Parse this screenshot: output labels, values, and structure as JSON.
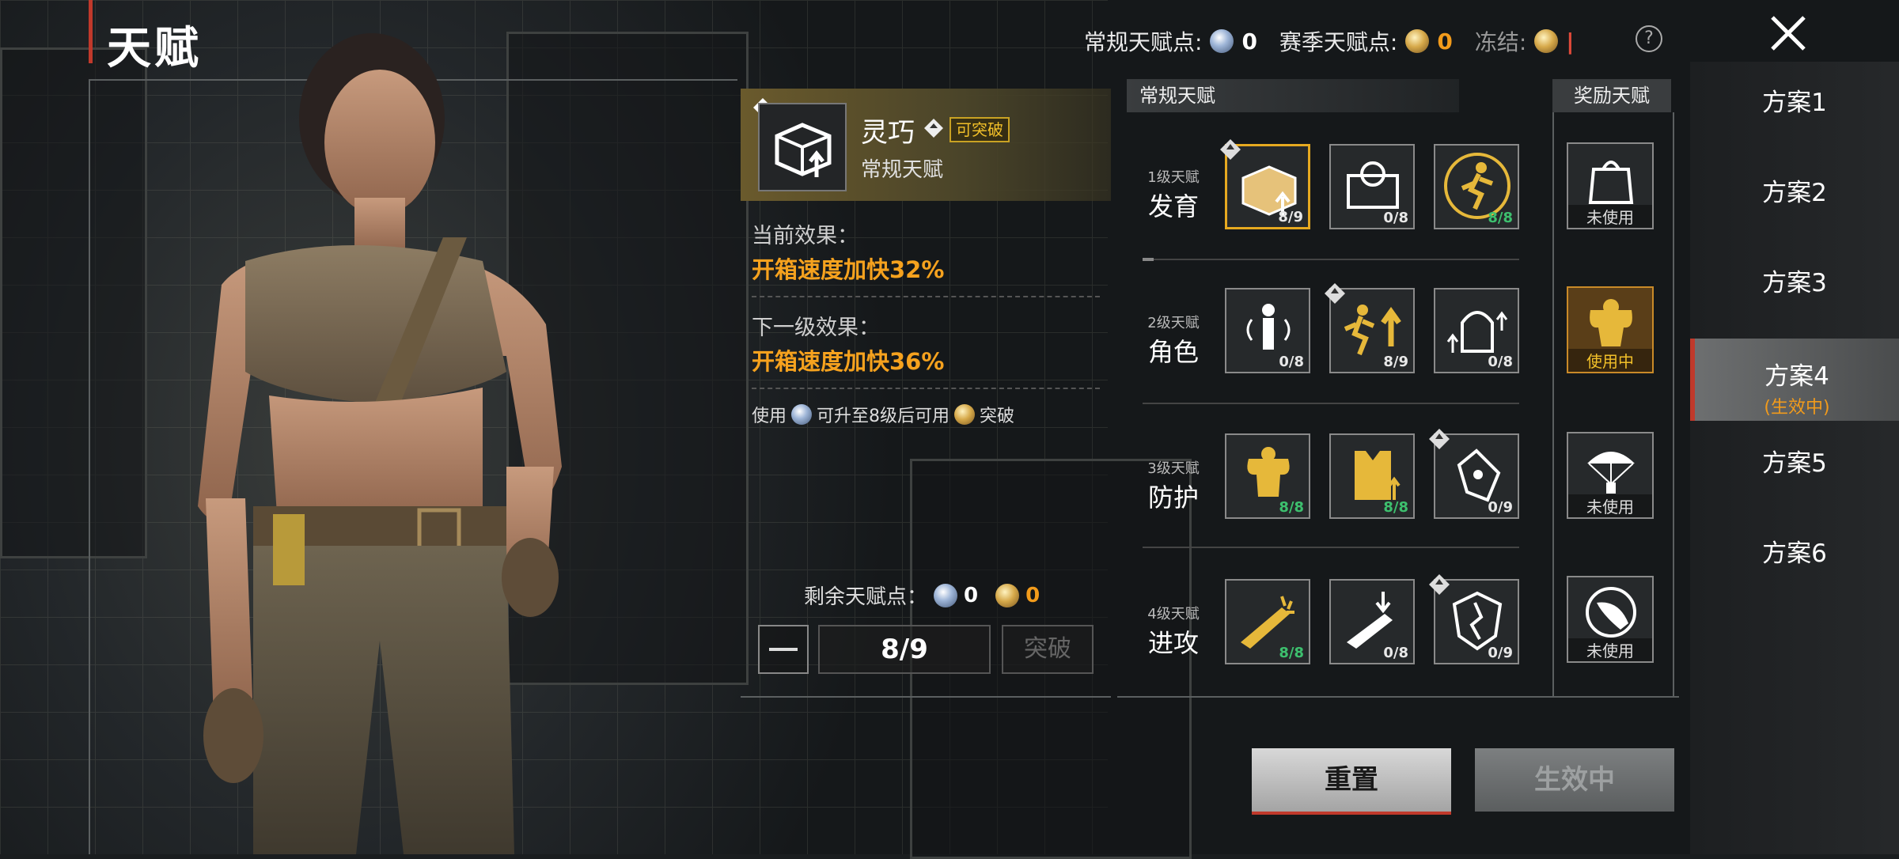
{
  "screen_title": "天赋",
  "header": {
    "regular_points_label": "常规天赋点:",
    "regular_points_value": "0",
    "season_points_label": "赛季天赋点:",
    "season_points_value": "0",
    "frozen_label": "冻结:",
    "frozen_value": "|",
    "help_icon": "?"
  },
  "detail": {
    "talent_name": "灵巧",
    "break_badge": "可突破",
    "talent_type": "常规天赋",
    "current_label": "当前效果：",
    "current_value": "开箱速度加快32%",
    "next_label": "下一级效果：",
    "next_value": "开箱速度加快36%",
    "usage_prefix": "使用",
    "usage_middle": "可升至8级后可用",
    "usage_suffix": "突破",
    "remaining_label": "剩余天赋点：",
    "remaining_regular": "0",
    "remaining_season": "0",
    "level_display": "8/9",
    "break_button": "突破"
  },
  "grid": {
    "regular_header": "常规天赋",
    "reward_header": "奖励天赋",
    "rows": [
      {
        "level": "1级天赋",
        "name": "发育",
        "tiles": [
          {
            "icon": "loot-box-icon",
            "count": "8/9",
            "green": false,
            "selected": true,
            "upgrade": true
          },
          {
            "icon": "supply-crate-icon",
            "count": "0/8",
            "green": false,
            "selected": false,
            "upgrade": false
          },
          {
            "icon": "sprint-runner-icon",
            "count": "8/8",
            "green": true,
            "selected": false,
            "upgrade": false
          }
        ],
        "reward": {
          "icon": "backpack-icon",
          "status": "未使用",
          "active": false
        }
      },
      {
        "level": "2级天赋",
        "name": "角色",
        "tiles": [
          {
            "icon": "sound-soldier-icon",
            "count": "0/8",
            "green": false,
            "selected": false,
            "upgrade": false
          },
          {
            "icon": "run-speed-icon",
            "count": "8/9",
            "green": false,
            "selected": false,
            "upgrade": true
          },
          {
            "icon": "helmet-backpack-icon",
            "count": "0/8",
            "green": false,
            "selected": false,
            "upgrade": false
          }
        ],
        "reward": {
          "icon": "strong-man-icon",
          "status": "使用中",
          "active": true
        }
      },
      {
        "level": "3级天赋",
        "name": "防护",
        "tiles": [
          {
            "icon": "muscle-soldier-icon",
            "count": "8/8",
            "green": true,
            "selected": false,
            "upgrade": false
          },
          {
            "icon": "armor-vest-icon",
            "count": "8/8",
            "green": true,
            "selected": false,
            "upgrade": false
          },
          {
            "icon": "glove-icon",
            "count": "0/9",
            "green": false,
            "selected": false,
            "upgrade": true
          }
        ],
        "reward": {
          "icon": "parachute-icon",
          "status": "未使用",
          "active": false
        }
      },
      {
        "level": "4级天赋",
        "name": "进攻",
        "tiles": [
          {
            "icon": "rifle-spark-icon",
            "count": "8/8",
            "green": true,
            "selected": false,
            "upgrade": false
          },
          {
            "icon": "rifle-reload-icon",
            "count": "0/8",
            "green": false,
            "selected": false,
            "upgrade": false
          },
          {
            "icon": "shield-crack-icon",
            "count": "0/9",
            "green": false,
            "selected": false,
            "upgrade": true
          }
        ],
        "reward": {
          "icon": "bullet-icon",
          "status": "未使用",
          "active": false
        }
      }
    ]
  },
  "buttons": {
    "reset": "重置",
    "in_effect": "生效中"
  },
  "schemes": [
    {
      "label": "方案1",
      "sub": "",
      "active": false
    },
    {
      "label": "方案2",
      "sub": "",
      "active": false
    },
    {
      "label": "方案3",
      "sub": "",
      "active": false
    },
    {
      "label": "方案4",
      "sub": "(生效中)",
      "active": true
    },
    {
      "label": "方案5",
      "sub": "",
      "active": false
    },
    {
      "label": "方案6",
      "sub": "",
      "active": false
    }
  ],
  "colors": {
    "accent_orange": "#f29b1b",
    "gold_select": "#e6a920",
    "green_count": "#3dc06e",
    "red_accent": "#c0392b"
  }
}
